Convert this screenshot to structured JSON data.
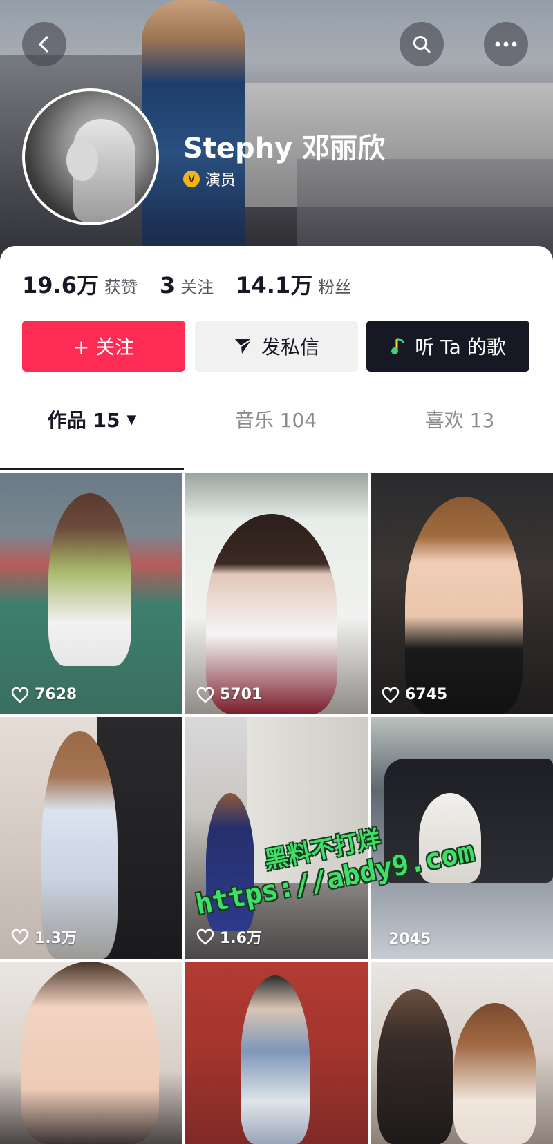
{
  "header": {
    "username": "Stephy 邓丽欣",
    "verification_label": "演员",
    "verification_badge_color": "#f2b21c",
    "icons": {
      "back": "back-arrow-icon",
      "search": "search-icon",
      "more": "more-icon"
    }
  },
  "stats": [
    {
      "value": "19.6万",
      "label": "获赞"
    },
    {
      "value": "3",
      "label": "关注"
    },
    {
      "value": "14.1万",
      "label": "粉丝"
    }
  ],
  "actions": {
    "follow_label": "+ 关注",
    "message_label": "发私信",
    "music_label": "听 Ta 的歌",
    "colors": {
      "follow": "#fe2c55",
      "message": "#f1f1f2",
      "music": "#161823"
    }
  },
  "tabs": [
    {
      "label": "作品 15",
      "active": true
    },
    {
      "label": "音乐 104",
      "active": false
    },
    {
      "label": "喜欢 13",
      "active": false
    }
  ],
  "videos": [
    {
      "likes": "7628"
    },
    {
      "likes": "5701"
    },
    {
      "likes": "6745"
    },
    {
      "likes": "1.3万"
    },
    {
      "likes": "1.6万"
    },
    {
      "likes": "2045"
    },
    {
      "likes": ""
    },
    {
      "likes": ""
    },
    {
      "likes": ""
    }
  ],
  "watermark": {
    "line1": "黑料不打烊",
    "line2": "https://abdy9.com",
    "color": "#3fe06a"
  }
}
